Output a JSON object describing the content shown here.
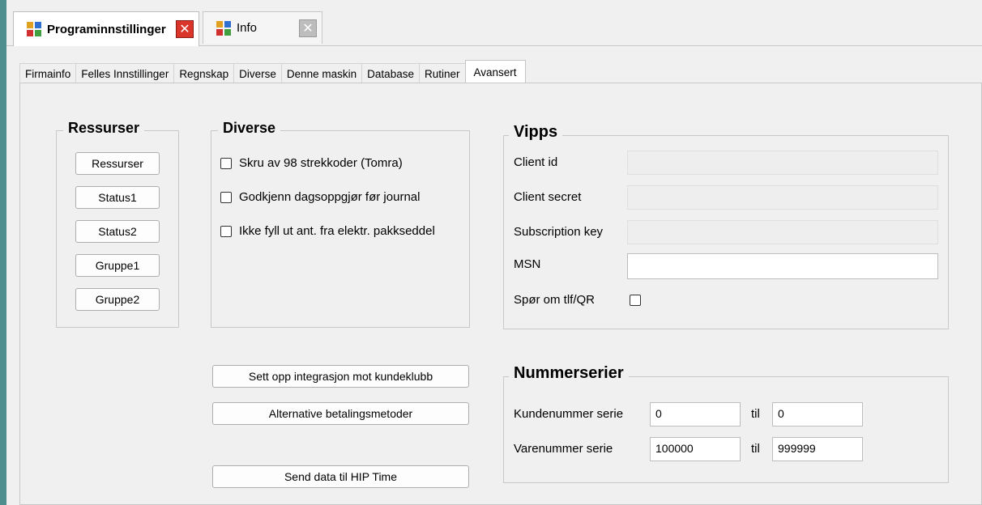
{
  "doc_tabs": [
    {
      "label": "Programinnstillinger",
      "active": true
    },
    {
      "label": "Info",
      "active": false
    }
  ],
  "settings_tabs": [
    "Firmainfo",
    "Felles Innstillinger",
    "Regnskap",
    "Diverse",
    "Denne maskin",
    "Database",
    "Rutiner",
    "Avansert"
  ],
  "active_settings_tab": "Avansert",
  "ressurser": {
    "title": "Ressurser",
    "buttons": [
      "Ressurser",
      "Status1",
      "Status2",
      "Gruppe1",
      "Gruppe2"
    ]
  },
  "diverse": {
    "title": "Diverse",
    "checkboxes": [
      {
        "label": "Skru av 98 strekkoder (Tomra)",
        "checked": false
      },
      {
        "label": "Godkjenn dagsoppgjør før journal",
        "checked": false
      },
      {
        "label": "Ikke fyll ut ant. fra elektr. pakkseddel",
        "checked": false
      }
    ]
  },
  "vipps": {
    "title": "Vipps",
    "client_id_label": "Client id",
    "client_id_value": "",
    "client_secret_label": "Client secret",
    "client_secret_value": "",
    "subscription_key_label": "Subscription key",
    "subscription_key_value": "",
    "msn_label": "MSN",
    "msn_value": "",
    "ask_phone_label": "Spør om tlf/QR",
    "ask_phone_checked": false
  },
  "actions": {
    "kundeklubb": "Sett opp integrasjon mot kundeklubb",
    "betalingsmetoder": "Alternative betalingsmetoder",
    "hip_time": "Send data til HIP Time"
  },
  "nummerserier": {
    "title": "Nummerserier",
    "kundenummer_label": "Kundenummer serie",
    "kundenummer_from": "0",
    "kundenummer_til_label": "til",
    "kundenummer_to": "0",
    "varenummer_label": "Varenummer serie",
    "varenummer_from": "100000",
    "varenummer_til_label": "til",
    "varenummer_to": "999999"
  },
  "colors": {
    "accent_bar": "#4f8e8e",
    "close_red": "#d9352a"
  }
}
